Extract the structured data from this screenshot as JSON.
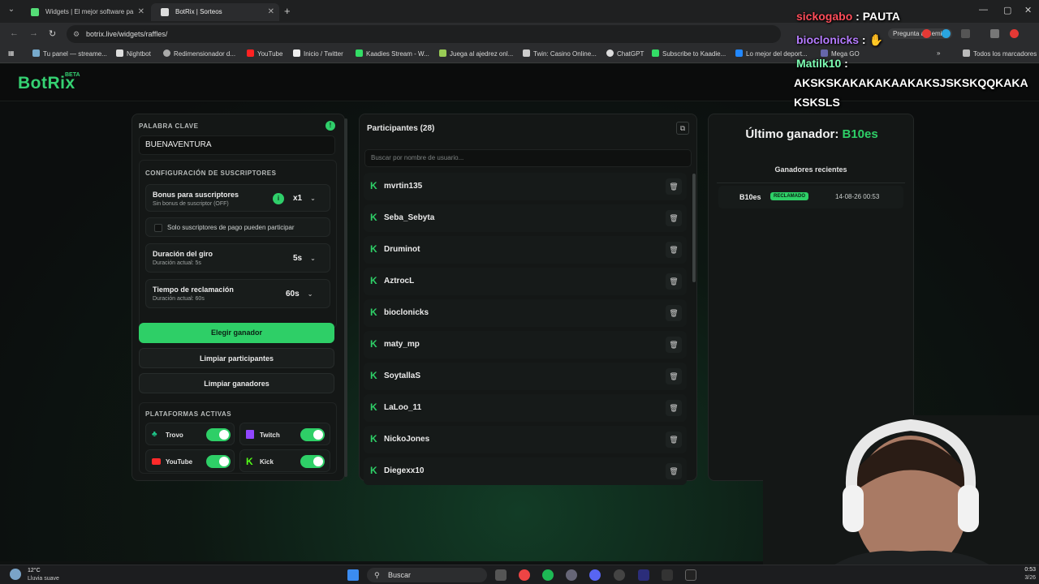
{
  "browser": {
    "tabs": [
      {
        "title": "Widgets | El mejor software pa",
        "active": false
      },
      {
        "title": "BotRix | Sorteos",
        "active": true
      }
    ],
    "url": "botrix.live/widgets/raffles/",
    "bookmarks": [
      "Tu panel — streame...",
      "Nightbot",
      "Redimensionador d...",
      "YouTube",
      "Inicio / Twitter",
      "Kaadies Stream - W...",
      "Juega al ajedrez onl...",
      "Twin: Casino Online...",
      "ChatGPT",
      "Subscribe to Kaadie...",
      "Lo mejor del deport...",
      "Mega GO"
    ],
    "bookmarks_folder": "Todos los marcadores",
    "gemini": "Pregunta a Gemini"
  },
  "app": {
    "logo": "BotRix",
    "logo_badge": "BETA"
  },
  "settings": {
    "keyword_label": "PALABRA CLAVE",
    "keyword_value": "BUENAVENTURA",
    "subs_section": "CONFIGURACIÓN DE SUSCRIPTORES",
    "bonus_title": "Bonus para suscriptores",
    "bonus_sub": "Sin bonus de suscriptor (OFF)",
    "bonus_value": "x1",
    "only_paid_label": "Solo suscriptores de pago pueden participar",
    "spin_title": "Duración del giro",
    "spin_sub": "Duración actual: 5s",
    "spin_value": "5s",
    "claim_title": "Tiempo de reclamación",
    "claim_sub": "Duración actual: 60s",
    "claim_value": "60s",
    "pick_winner": "Elegir ganador",
    "clear_participants": "Limpiar participantes",
    "clear_winners": "Limpiar ganadores",
    "platforms_label": "PLATAFORMAS ACTIVAS",
    "platforms": [
      {
        "name": "Trovo",
        "enabled": true,
        "color": "#1ec88a"
      },
      {
        "name": "Twitch",
        "enabled": true,
        "color": "#9146ff"
      },
      {
        "name": "YouTube",
        "enabled": true,
        "color": "#ff2a2a"
      },
      {
        "name": "Kick",
        "enabled": true,
        "color": "#53fc18"
      }
    ]
  },
  "participants": {
    "title": "Participantes (28)",
    "search_placeholder": "Buscar por nombre de usuario...",
    "list": [
      "mvrtin135",
      "Seba_Sebyta",
      "Druminot",
      "AztrocL",
      "bioclonicks",
      "maty_mp",
      "SoytallaS",
      "LaLoo_11",
      "NickoJones",
      "Diegexx10"
    ]
  },
  "winner": {
    "last_label": "Último ganador:",
    "last_name": "B10es",
    "recent_title": "Ganadores recientes",
    "recent": [
      {
        "name": "B10es",
        "status": "RECLAMADO",
        "time": "14-08-26 00:53"
      }
    ]
  },
  "chat_overlay": [
    {
      "user": "sickogabo",
      "msg": ": PAUTA",
      "color": "#ff4d5a"
    },
    {
      "user": "bioclonicks",
      "msg": ":",
      "color": "#b57bff"
    },
    {
      "user": "Matilk10",
      "msg": ":",
      "color": "#7dffb3"
    },
    {
      "user": "",
      "msg": "AKSKSKAKAKAKAAKAKSJSKSKQQKAKA",
      "color": "#ffffff"
    },
    {
      "user": "",
      "msg": "KSKSLS",
      "color": "#ffffff"
    }
  ],
  "taskbar": {
    "weather_temp": "12°C",
    "weather_desc": "Lluvia suave",
    "search": "Buscar",
    "time": "0:53",
    "date": "3/26"
  }
}
